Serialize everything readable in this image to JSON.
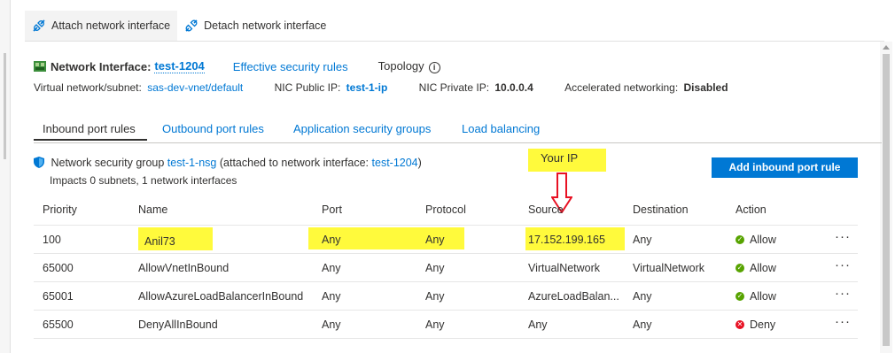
{
  "toolbar": {
    "attach_label": "Attach network interface",
    "detach_label": "Detach network interface"
  },
  "nic": {
    "label": "Network Interface:",
    "name": "test-1204",
    "effective_rules_link": "Effective security rules",
    "topology_label": "Topology",
    "vnet_label": "Virtual network/subnet:",
    "vnet_value": "sas-dev-vnet/default",
    "public_ip_label": "NIC Public IP:",
    "public_ip_value": "test-1-ip",
    "private_ip_label": "NIC Private IP:",
    "private_ip_value": "10.0.0.4",
    "accel_label": "Accelerated networking:",
    "accel_value": "Disabled"
  },
  "tabs": [
    {
      "label": "Inbound port rules"
    },
    {
      "label": "Outbound port rules"
    },
    {
      "label": "Application security groups"
    },
    {
      "label": "Load balancing"
    }
  ],
  "nsg": {
    "prefix": "Network security group",
    "name": "test-1-nsg",
    "middle": "(attached to network interface:",
    "nic_link": "test-1204",
    "suffix": ")",
    "impacts": "Impacts 0 subnets, 1 network interfaces"
  },
  "annotation": {
    "your_ip": "Your IP"
  },
  "add_rule_label": "Add inbound port rule",
  "columns": {
    "priority": "Priority",
    "name": "Name",
    "port": "Port",
    "protocol": "Protocol",
    "source": "Source",
    "destination": "Destination",
    "action": "Action"
  },
  "rows": [
    {
      "priority": "100",
      "name": "Anil73",
      "port": "Any",
      "protocol": "Any",
      "source": "17.152.199.165",
      "destination": "Any",
      "action": "Allow",
      "more": "···"
    },
    {
      "priority": "65000",
      "name": "AllowVnetInBound",
      "port": "Any",
      "protocol": "Any",
      "source": "VirtualNetwork",
      "destination": "VirtualNetwork",
      "action": "Allow",
      "more": "···"
    },
    {
      "priority": "65001",
      "name": "AllowAzureLoadBalancerInBound",
      "port": "Any",
      "protocol": "Any",
      "source": "AzureLoadBalan...",
      "destination": "Any",
      "action": "Allow",
      "more": "···"
    },
    {
      "priority": "65500",
      "name": "DenyAllInBound",
      "port": "Any",
      "protocol": "Any",
      "source": "Any",
      "destination": "Any",
      "action": "Deny",
      "more": "···"
    }
  ],
  "colors": {
    "accent": "#0078d4",
    "allow": "#57a300",
    "deny": "#e81123",
    "highlight": "#fffa3c",
    "annotation_arrow": "#e81123"
  }
}
